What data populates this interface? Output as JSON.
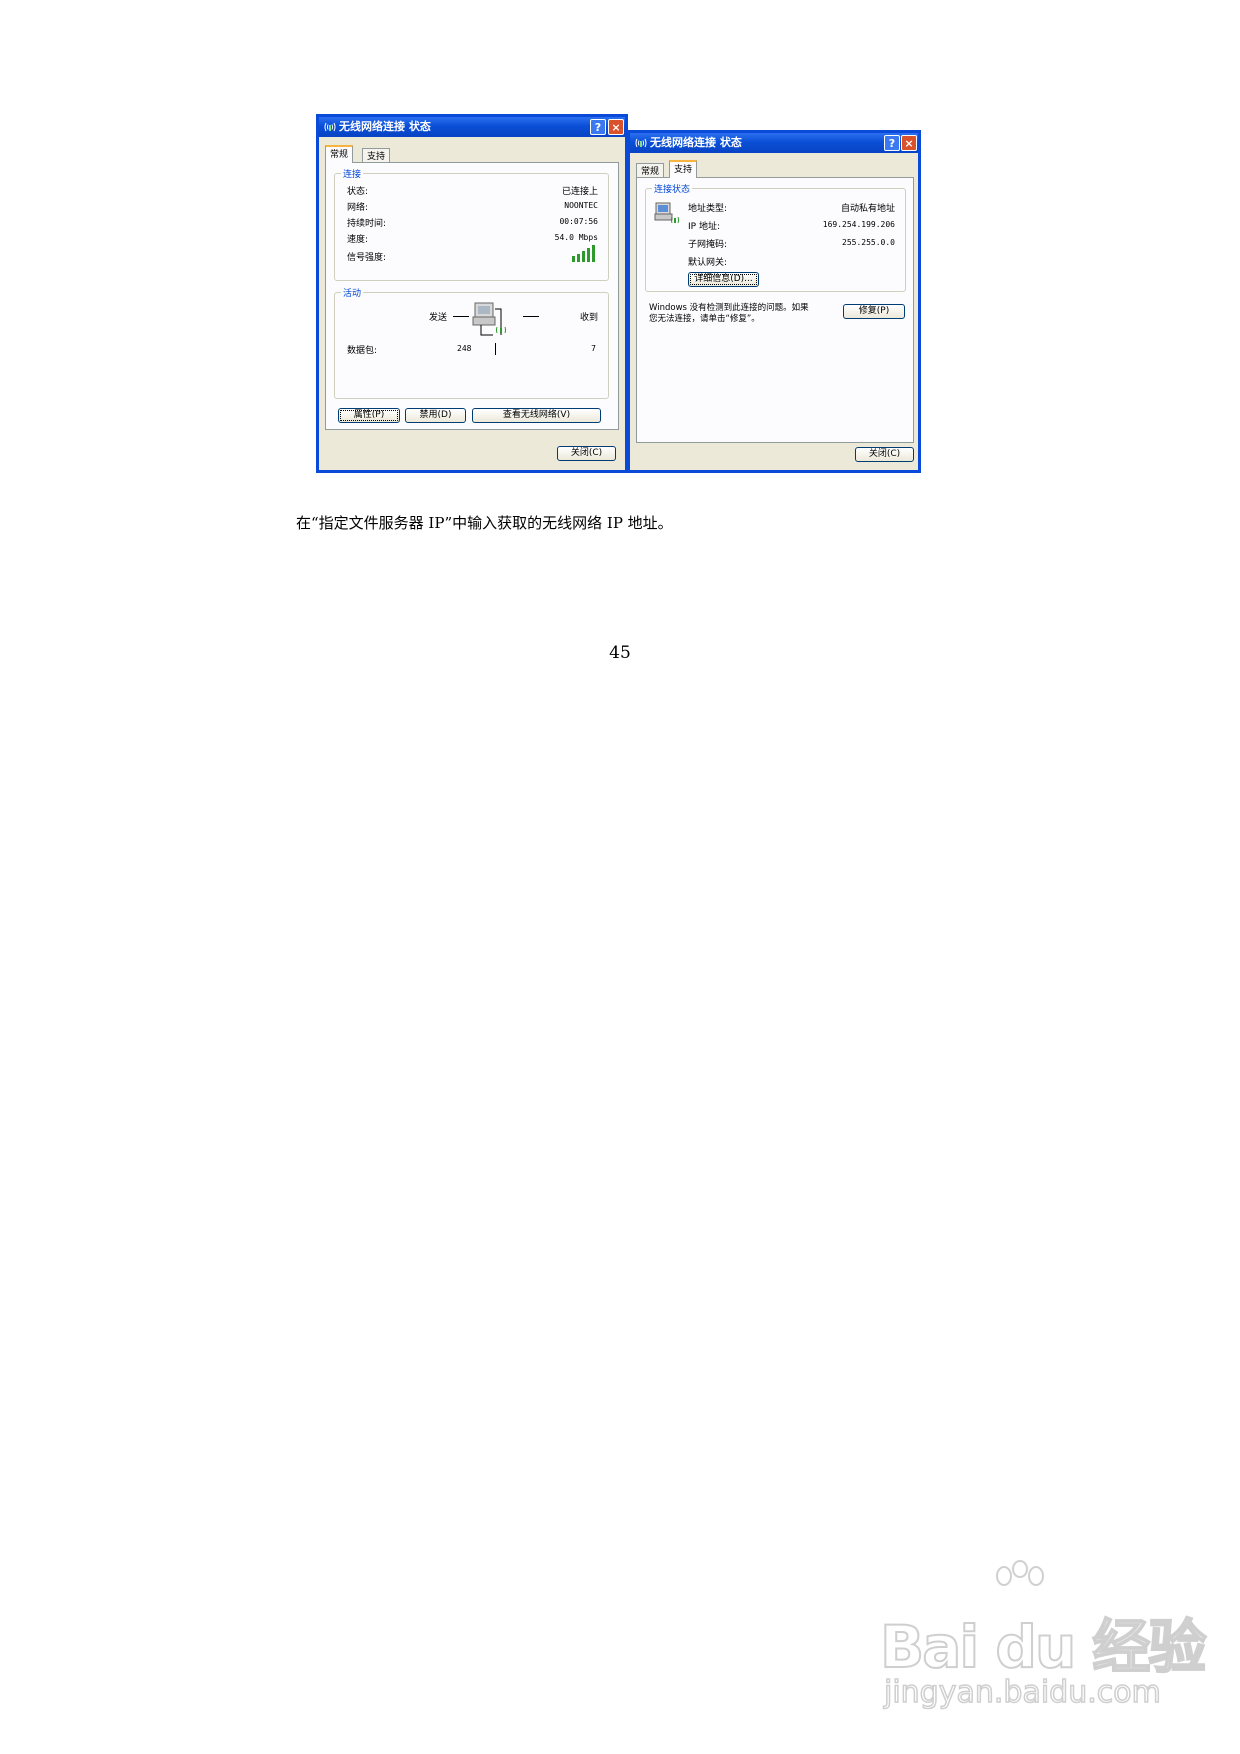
{
  "dialog_left": {
    "title": "无线网络连接 状态",
    "help": "?",
    "close": "×",
    "tabs": [
      "常规",
      "支持"
    ],
    "connection": {
      "legend": "连接",
      "rows": [
        {
          "label": "状态:",
          "value": "已连接上"
        },
        {
          "label": "网络:",
          "value": "NOONTEC"
        },
        {
          "label": "持续时间:",
          "value": "00:07:56"
        },
        {
          "label": "速度:",
          "value": "54.0 Mbps"
        },
        {
          "label": "信号强度:",
          "value": ""
        }
      ]
    },
    "activity": {
      "legend": "活动",
      "sent_label": "发送",
      "received_label": "收到",
      "packets_label": "数据包:",
      "sent_value": "248",
      "received_value": "7"
    },
    "buttons": {
      "properties": "属性(P)",
      "disable": "禁用(D)",
      "view_networks": "查看无线网络(V)",
      "close": "关闭(C)"
    }
  },
  "dialog_right": {
    "title": "无线网络连接 状态",
    "help": "?",
    "close": "×",
    "tabs": [
      "常规",
      "支持"
    ],
    "status": {
      "legend": "连接状态",
      "rows": [
        {
          "label": "地址类型:",
          "value": "自动私有地址"
        },
        {
          "label": "IP 地址:",
          "value": "169.254.199.206"
        },
        {
          "label": "子网掩码:",
          "value": "255.255.0.0"
        },
        {
          "label": "默认网关:",
          "value": ""
        }
      ],
      "details_button": "详细信息(D)..."
    },
    "repair_text_line1": "Windows 没有检测到此连接的问题。如果",
    "repair_text_line2": "您无法连接，请单击“修复”。",
    "repair_button": "修复(P)",
    "close_button": "关闭(C)"
  },
  "caption": "在“指定文件服务器 IP”中输入获取的无线网络 IP 地址。",
  "page_number": "45",
  "watermark": {
    "main": "Bai du 经验",
    "sub": "jingyan.baidu.com"
  }
}
